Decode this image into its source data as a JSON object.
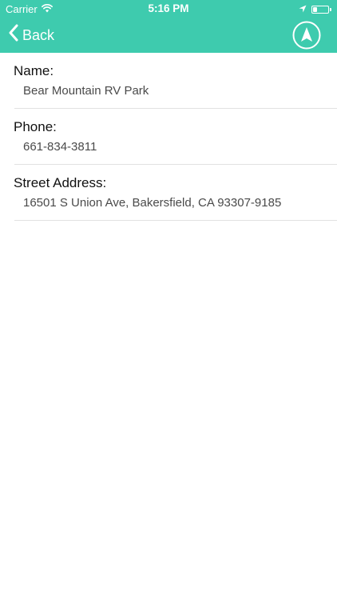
{
  "status_bar": {
    "carrier": "Carrier",
    "time": "5:16 PM",
    "battery_level": 0.3
  },
  "nav": {
    "back_label": "Back"
  },
  "details": [
    {
      "label": "Name:",
      "value": "Bear Mountain RV Park"
    },
    {
      "label": "Phone:",
      "value": "661-834-3811"
    },
    {
      "label": "Street Address:",
      "value": "16501 S Union Ave, Bakersfield, CA 93307-9185"
    }
  ],
  "colors": {
    "header": "#3ecbae",
    "header_text": "#ffffff",
    "label": "#111111",
    "value": "#4a4a4a",
    "divider": "#e2e2e2"
  }
}
